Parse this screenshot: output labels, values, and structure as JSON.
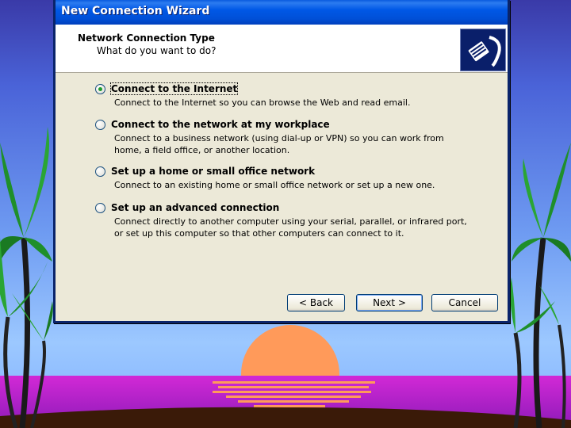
{
  "window": {
    "title": "New Connection Wizard"
  },
  "header": {
    "title": "Network Connection Type",
    "subtitle": "What do you want to do?",
    "icon": "network-cable-icon"
  },
  "options": [
    {
      "label": "Connect to the Internet",
      "description": "Connect to the Internet so you can browse the Web and read email.",
      "selected": true
    },
    {
      "label": "Connect to the network at my workplace",
      "description": "Connect to a business network (using dial-up or VPN) so you can work from home, a field office, or another location.",
      "selected": false
    },
    {
      "label": "Set up a home or small office network",
      "description": "Connect to an existing home or small office network or set up a new one.",
      "selected": false
    },
    {
      "label": "Set up an advanced connection",
      "description": "Connect directly to another computer using your serial, parallel, or infrared port, or set up this computer so that other computers can connect to it.",
      "selected": false
    }
  ],
  "buttons": {
    "back": "< Back",
    "next": "Next >",
    "cancel": "Cancel"
  },
  "colors": {
    "titlebar": "#0058e6",
    "dialog_bg": "#ece9d8",
    "sun": "#ff9a5a",
    "water": "#b81fd0"
  }
}
